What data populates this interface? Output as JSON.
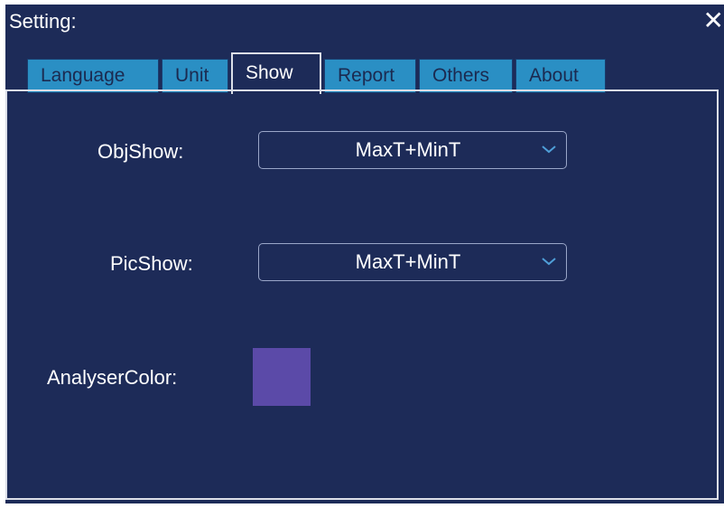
{
  "window": {
    "title": "Setting:",
    "close_label": "✕"
  },
  "tabs": [
    {
      "label": "Language",
      "active": false
    },
    {
      "label": "Unit",
      "active": false
    },
    {
      "label": "Show",
      "active": true
    },
    {
      "label": "Report",
      "active": false
    },
    {
      "label": "Others",
      "active": false
    },
    {
      "label": "About",
      "active": false
    }
  ],
  "show": {
    "obj_show_label": "ObjShow:",
    "obj_show_value": "MaxT+MinT",
    "pic_show_label": "PicShow:",
    "pic_show_value": "MaxT+MinT",
    "analyser_color_label": "AnalyserColor:",
    "analyser_color": "#5b4aa8"
  },
  "colors": {
    "background": "#1d2b58",
    "tab_inactive": "#2a8fc4",
    "border": "#dcdfe8"
  },
  "icons": {
    "close": "close-icon",
    "dropdown": "chevron-down-icon"
  }
}
